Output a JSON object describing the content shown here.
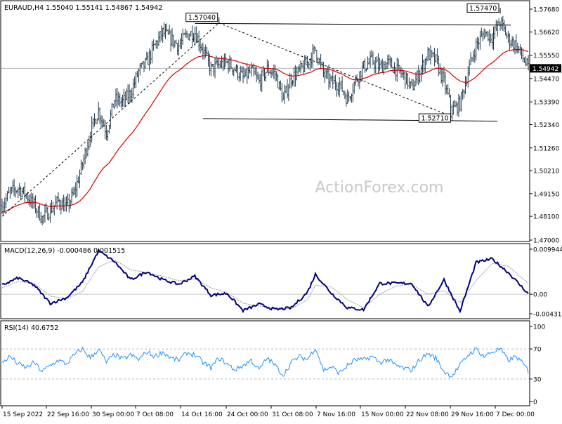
{
  "chart_data": [
    {
      "type": "candlestick",
      "title": "EURAUD,H4  1.55040 1.55141 1.54867 1.54942",
      "watermark": "ActionForex.com",
      "ylim": [
        1.47,
        1.5768
      ],
      "y_ticks": [
        1.5768,
        1.5662,
        1.5555,
        1.5447,
        1.5339,
        1.5234,
        1.5126,
        1.5021,
        1.4915,
        1.481,
        1.47
      ],
      "y_tick_labels": [
        "1.57680",
        "1.56620",
        "1.55550",
        "1.54470",
        "1.53390",
        "1.52340",
        "1.51260",
        "1.50210",
        "1.49150",
        "1.48100",
        "1.47000"
      ],
      "last_price": 1.54942,
      "last_price_label": "1.54942",
      "x_ticks": [
        "15 Sep 2022",
        "22 Sep 16:00",
        "30 Sep 00:00",
        "7 Oct 08:00",
        "14 Oct 16:00",
        "24 Oct 00:00",
        "31 Oct 08:00",
        "7 Nov 16:00",
        "15 Nov 00:00",
        "22 Nov 08:00",
        "29 Nov 16:00",
        "7 Dec 00:00"
      ],
      "close_path": [
        [
          0,
          1.486
        ],
        [
          6,
          1.492
        ],
        [
          12,
          1.494
        ],
        [
          18,
          1.491
        ],
        [
          24,
          1.486
        ],
        [
          30,
          1.48
        ],
        [
          36,
          1.484
        ],
        [
          42,
          1.488
        ],
        [
          48,
          1.485
        ],
        [
          54,
          1.492
        ],
        [
          60,
          1.505
        ],
        [
          66,
          1.52
        ],
        [
          72,
          1.53
        ],
        [
          78,
          1.52
        ],
        [
          84,
          1.535
        ],
        [
          90,
          1.534
        ],
        [
          96,
          1.538
        ],
        [
          102,
          1.548
        ],
        [
          108,
          1.552
        ],
        [
          114,
          1.56
        ],
        [
          120,
          1.566
        ],
        [
          126,
          1.563
        ],
        [
          132,
          1.56
        ],
        [
          138,
          1.565
        ],
        [
          144,
          1.566
        ],
        [
          150,
          1.558
        ],
        [
          156,
          1.549
        ],
        [
          162,
          1.551
        ],
        [
          168,
          1.552
        ],
        [
          174,
          1.549
        ],
        [
          180,
          1.545
        ],
        [
          186,
          1.548
        ],
        [
          192,
          1.543
        ],
        [
          198,
          1.549
        ],
        [
          204,
          1.547
        ],
        [
          210,
          1.535
        ],
        [
          216,
          1.545
        ],
        [
          222,
          1.548
        ],
        [
          228,
          1.552
        ],
        [
          234,
          1.558
        ],
        [
          240,
          1.547
        ],
        [
          246,
          1.543
        ],
        [
          252,
          1.542
        ],
        [
          258,
          1.535
        ],
        [
          264,
          1.544
        ],
        [
          270,
          1.55
        ],
        [
          276,
          1.553
        ],
        [
          282,
          1.55
        ],
        [
          288,
          1.552
        ],
        [
          294,
          1.549
        ],
        [
          300,
          1.546
        ],
        [
          306,
          1.54
        ],
        [
          312,
          1.548
        ],
        [
          318,
          1.556
        ],
        [
          324,
          1.553
        ],
        [
          330,
          1.543
        ],
        [
          336,
          1.53
        ],
        [
          342,
          1.533
        ],
        [
          348,
          1.548
        ],
        [
          354,
          1.56
        ],
        [
          360,
          1.566
        ],
        [
          366,
          1.564
        ],
        [
          372,
          1.571
        ],
        [
          378,
          1.563
        ],
        [
          384,
          1.56
        ],
        [
          390,
          1.553
        ],
        [
          393,
          1.5494
        ]
      ],
      "annotations": [
        {
          "label": "1.57040",
          "price": 1.5704,
          "bar": 162
        },
        {
          "label": "1.52710",
          "price": 1.5271,
          "bar": 336
        },
        {
          "label": "1.57470",
          "price": 1.5747,
          "bar": 372
        }
      ],
      "trend_lines": [
        {
          "style": "solid",
          "from": [
            144,
            1.5702
          ],
          "to": [
            380,
            1.5694
          ]
        },
        {
          "style": "solid",
          "from": [
            150,
            1.5262
          ],
          "to": [
            370,
            1.525
          ]
        },
        {
          "style": "dashed",
          "from": [
            0,
            1.481
          ],
          "to": [
            162,
            1.5704
          ]
        },
        {
          "style": "dashed",
          "from": [
            162,
            1.5704
          ],
          "to": [
            336,
            1.5271
          ]
        }
      ],
      "moving_average": {
        "color": "#d40000",
        "period": 55
      }
    },
    {
      "type": "line",
      "title": "MACD(12,26,9) -0.000486 0.001515",
      "ylim": [
        -0.004313,
        0.009944
      ],
      "y_ticks": [
        0.009944,
        0.0,
        -0.004313
      ],
      "y_tick_labels": [
        "0.009944",
        "0.00",
        "-0.004313"
      ],
      "series": [
        {
          "name": "MACD",
          "color": "#000080",
          "points": [
            [
              0,
              0.002
            ],
            [
              12,
              0.0036
            ],
            [
              24,
              0.002
            ],
            [
              36,
              -0.002
            ],
            [
              48,
              -0.0008
            ],
            [
              60,
              0.0026
            ],
            [
              72,
              0.0096
            ],
            [
              84,
              0.0072
            ],
            [
              96,
              0.0032
            ],
            [
              108,
              0.005
            ],
            [
              120,
              0.0032
            ],
            [
              132,
              0.0022
            ],
            [
              144,
              0.004
            ],
            [
              156,
              -0.0002
            ],
            [
              168,
              0.0002
            ],
            [
              180,
              -0.0036
            ],
            [
              192,
              -0.0022
            ],
            [
              204,
              -0.0034
            ],
            [
              216,
              -0.003
            ],
            [
              228,
              0.0004
            ],
            [
              234,
              0.0044
            ],
            [
              246,
              0.0002
            ],
            [
              258,
              -0.003
            ],
            [
              270,
              -0.0034
            ],
            [
              282,
              0.0024
            ],
            [
              294,
              0.0024
            ],
            [
              306,
              0.0024
            ],
            [
              318,
              -0.0028
            ],
            [
              330,
              0.0032
            ],
            [
              342,
              -0.0038
            ],
            [
              354,
              0.007
            ],
            [
              366,
              0.0078
            ],
            [
              378,
              0.0048
            ],
            [
              393,
              0.0001
            ]
          ]
        },
        {
          "name": "Signal",
          "color": "#a0a0a0",
          "points": [
            [
              0,
              0.0014
            ],
            [
              12,
              0.0028
            ],
            [
              24,
              0.0024
            ],
            [
              36,
              -0.0004
            ],
            [
              48,
              -0.001
            ],
            [
              60,
              0.0006
            ],
            [
              72,
              0.006
            ],
            [
              84,
              0.0076
            ],
            [
              96,
              0.0054
            ],
            [
              108,
              0.0048
            ],
            [
              120,
              0.004
            ],
            [
              132,
              0.003
            ],
            [
              144,
              0.0034
            ],
            [
              156,
              0.0014
            ],
            [
              168,
              0.0004
            ],
            [
              180,
              -0.002
            ],
            [
              192,
              -0.0026
            ],
            [
              204,
              -0.003
            ],
            [
              216,
              -0.0032
            ],
            [
              228,
              -0.0012
            ],
            [
              234,
              0.002
            ],
            [
              246,
              0.0016
            ],
            [
              258,
              -0.0012
            ],
            [
              270,
              -0.003
            ],
            [
              282,
              0.0
            ],
            [
              294,
              0.0018
            ],
            [
              306,
              0.0022
            ],
            [
              318,
              0.0
            ],
            [
              330,
              0.0008
            ],
            [
              342,
              -0.0018
            ],
            [
              354,
              0.003
            ],
            [
              366,
              0.0068
            ],
            [
              378,
              0.0062
            ],
            [
              393,
              0.0024
            ]
          ]
        }
      ]
    },
    {
      "type": "line",
      "title": "RSI(14) 40.6752",
      "ylim": [
        0,
        100
      ],
      "y_ticks": [
        100,
        70,
        30,
        0
      ],
      "y_tick_labels": [
        "100",
        "70",
        "30",
        "0"
      ],
      "levels": [
        70,
        30
      ],
      "series": [
        {
          "name": "RSI",
          "color": "#1e90ff",
          "points": [
            [
              0,
              52
            ],
            [
              6,
              60
            ],
            [
              12,
              50
            ],
            [
              18,
              45
            ],
            [
              24,
              52
            ],
            [
              30,
              40
            ],
            [
              36,
              48
            ],
            [
              42,
              55
            ],
            [
              48,
              50
            ],
            [
              54,
              62
            ],
            [
              60,
              70
            ],
            [
              66,
              58
            ],
            [
              72,
              70
            ],
            [
              78,
              52
            ],
            [
              84,
              63
            ],
            [
              90,
              56
            ],
            [
              96,
              62
            ],
            [
              102,
              56
            ],
            [
              108,
              66
            ],
            [
              114,
              60
            ],
            [
              120,
              66
            ],
            [
              126,
              58
            ],
            [
              132,
              55
            ],
            [
              138,
              65
            ],
            [
              144,
              62
            ],
            [
              150,
              52
            ],
            [
              156,
              45
            ],
            [
              162,
              58
            ],
            [
              168,
              50
            ],
            [
              174,
              42
            ],
            [
              180,
              48
            ],
            [
              186,
              55
            ],
            [
              192,
              42
            ],
            [
              198,
              58
            ],
            [
              204,
              48
            ],
            [
              210,
              35
            ],
            [
              216,
              52
            ],
            [
              222,
              60
            ],
            [
              228,
              56
            ],
            [
              234,
              72
            ],
            [
              240,
              42
            ],
            [
              246,
              46
            ],
            [
              252,
              38
            ],
            [
              258,
              48
            ],
            [
              264,
              56
            ],
            [
              270,
              55
            ],
            [
              276,
              60
            ],
            [
              282,
              52
            ],
            [
              288,
              56
            ],
            [
              294,
              48
            ],
            [
              300,
              44
            ],
            [
              306,
              42
            ],
            [
              312,
              56
            ],
            [
              318,
              64
            ],
            [
              324,
              58
            ],
            [
              330,
              40
            ],
            [
              336,
              34
            ],
            [
              342,
              48
            ],
            [
              348,
              62
            ],
            [
              354,
              70
            ],
            [
              360,
              60
            ],
            [
              366,
              66
            ],
            [
              372,
              70
            ],
            [
              378,
              55
            ],
            [
              384,
              60
            ],
            [
              390,
              48
            ],
            [
              393,
              40.7
            ]
          ]
        }
      ]
    }
  ]
}
